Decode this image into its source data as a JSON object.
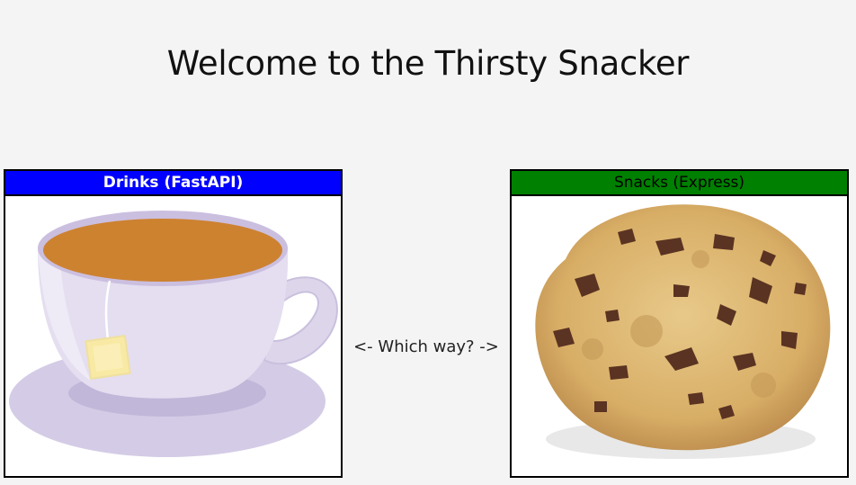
{
  "page": {
    "title": "Welcome to the Thirsty Snacker"
  },
  "drinks": {
    "label": "Drinks (FastAPI)",
    "header_color": "#0000ff",
    "image": "tea-cup-icon"
  },
  "snacks": {
    "label": "Snacks (Express)",
    "header_color": "#008000",
    "image": "chocolate-chip-cookie-icon"
  },
  "navigation": {
    "prompt": "<- Which way? ->"
  }
}
